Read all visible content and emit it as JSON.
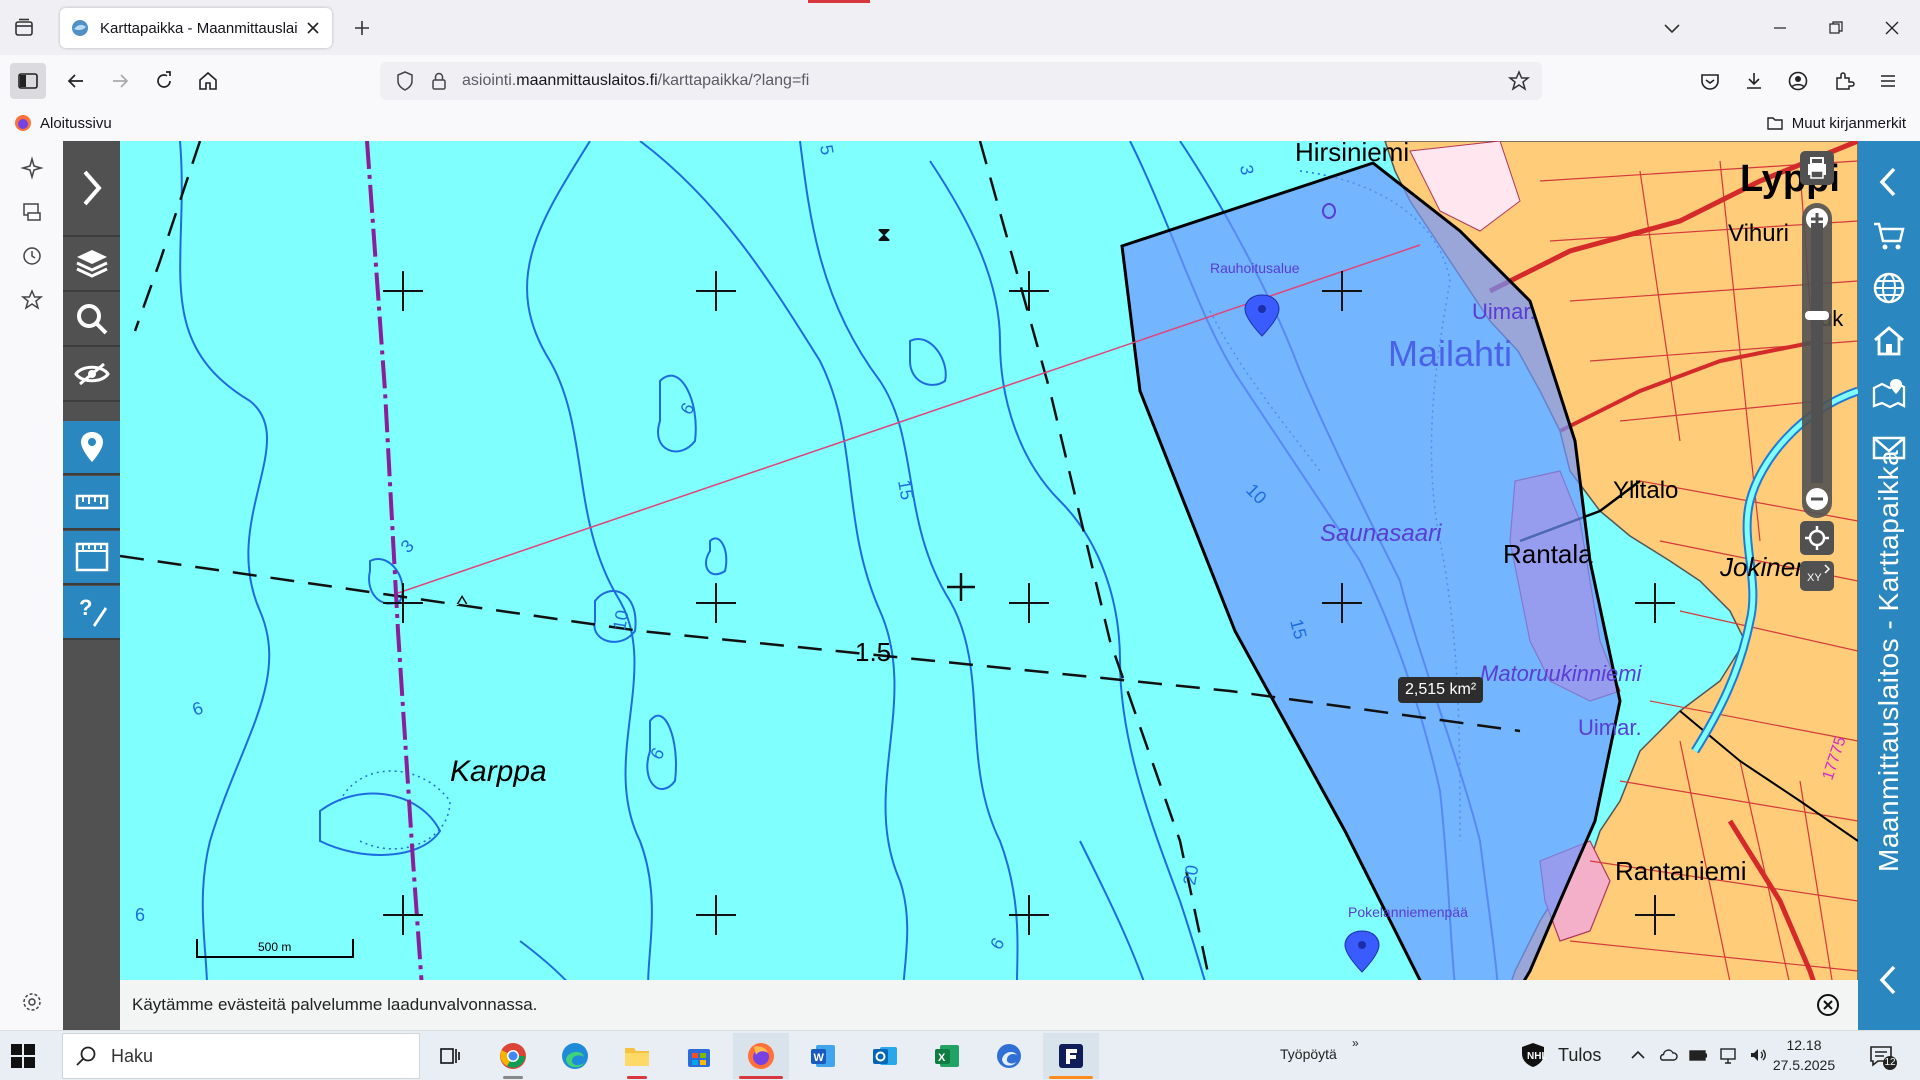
{
  "browser": {
    "tab_title": "Karttapaikka - Maanmittauslaitos",
    "url_prefix": "asiointi.",
    "url_domain": "maanmittauslaitos.fi",
    "url_path": "/karttapaikka/?lang=fi",
    "bookmark_home": "Aloitussivu",
    "bookmark_other": "Muut kirjanmerkit"
  },
  "app": {
    "vertical_title": "Maanmittauslaitos - Karttapaikka",
    "cookie_notice": "Käytämme evästeitä palvelumme laadunvalvonnassa.",
    "scale_label": "500 m",
    "area_measure": "2,515 km²",
    "accent_color": "#2a87c0",
    "toolbar_color": "#515151"
  },
  "map": {
    "labels": {
      "hirsiniemi": "Hirsiniemi",
      "lyppi": "Lyppi",
      "vihuri": "Vihuri",
      "uk": "uk",
      "rauhoitusalue": "Rauhoitusalue",
      "uimar1": "Uimar.",
      "mailahti": "Mailahti",
      "ylitalo": "Ylitalo",
      "saunasaari": "Saunasaari",
      "rantala": "Rantala",
      "jokinen": "Jokinen",
      "matoruukinniemi": "Matoruukinniemi",
      "uimar2": "Uimar.",
      "karppa": "Karppa",
      "rantaniemi": "Rantaniemi",
      "pokelanniemenpaa": "Pokelanniemenpää",
      "road_number": "17775",
      "d15": "1.5",
      "c3": "3",
      "c5": "5",
      "c6a": "6",
      "c6b": "6",
      "c6c": "6",
      "c6d": "6",
      "c6e": "6",
      "c10a": "10",
      "c10b": "10",
      "c15a": "15",
      "c15b": "15",
      "c20": "20",
      "c3b": "3"
    }
  },
  "taskbar": {
    "search_placeholder": "Haku",
    "desktop_label": "Työpöytä",
    "weather": "Tulos",
    "time": "12.18",
    "date": "27.5.2025",
    "notif_count": "12"
  }
}
